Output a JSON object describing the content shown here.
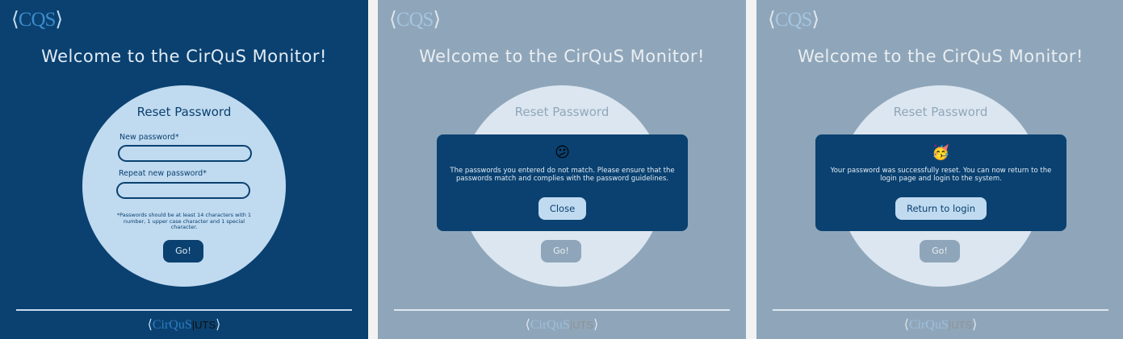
{
  "header": {
    "logo_open": "⟨",
    "logo_text": "CQS",
    "logo_close": "⟩",
    "title": "Welcome to the CirQuS Monitor!"
  },
  "reset_card": {
    "title": "Reset Password",
    "new_password_label": "New password*",
    "repeat_password_label": "Repeat new password*",
    "note": "*Passwords should be at least 14 characters with 1 number, 1 upper case character and 1 special character.",
    "go_label": "Go!"
  },
  "footer": {
    "open": "⟨",
    "cirqus": "CirQuS",
    "sep": "|",
    "uts": "UTS",
    "close": "⟩"
  },
  "mismatch_dialog": {
    "icon": "confused-face-icon",
    "emoji": "😕",
    "message": "The passwords you entered do not match. Please ensure that the passwords match and complies with the password guidelines.",
    "button_label": "Close"
  },
  "success_dialog": {
    "icon": "party-face-icon",
    "emoji": "🥳",
    "message": "Your password was successfully reset. You can now return to the login page and login to the system.",
    "button_label": "Return to login"
  },
  "colors": {
    "primary": "#0a4170",
    "light": "#c0daf0",
    "accent": "#3d8bcc"
  }
}
